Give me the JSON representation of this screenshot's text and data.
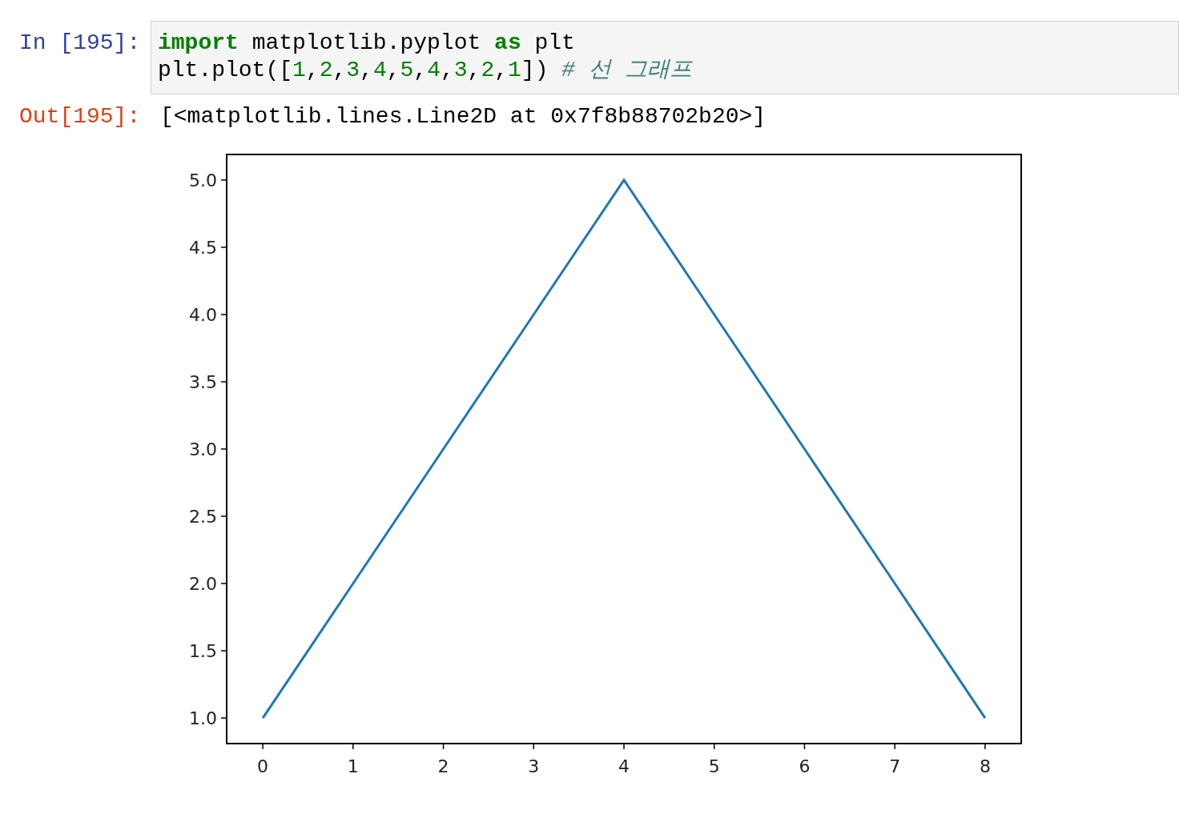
{
  "input_cell": {
    "prompt": "In [195]:",
    "code_lines": [
      [
        {
          "text": "import",
          "kind": "keyword"
        },
        {
          "text": " matplotlib.pyplot ",
          "kind": "plain"
        },
        {
          "text": "as",
          "kind": "keyword"
        },
        {
          "text": " plt",
          "kind": "plain"
        }
      ],
      [
        {
          "text": "plt.plot([",
          "kind": "plain"
        },
        {
          "text": "1",
          "kind": "number"
        },
        {
          "text": ",",
          "kind": "plain"
        },
        {
          "text": "2",
          "kind": "number"
        },
        {
          "text": ",",
          "kind": "plain"
        },
        {
          "text": "3",
          "kind": "number"
        },
        {
          "text": ",",
          "kind": "plain"
        },
        {
          "text": "4",
          "kind": "number"
        },
        {
          "text": ",",
          "kind": "plain"
        },
        {
          "text": "5",
          "kind": "number"
        },
        {
          "text": ",",
          "kind": "plain"
        },
        {
          "text": "4",
          "kind": "number"
        },
        {
          "text": ",",
          "kind": "plain"
        },
        {
          "text": "3",
          "kind": "number"
        },
        {
          "text": ",",
          "kind": "plain"
        },
        {
          "text": "2",
          "kind": "number"
        },
        {
          "text": ",",
          "kind": "plain"
        },
        {
          "text": "1",
          "kind": "number"
        },
        {
          "text": "]) ",
          "kind": "plain"
        },
        {
          "text": "# 선 그래프",
          "kind": "comment"
        }
      ]
    ]
  },
  "output_cell": {
    "prompt": "Out[195]:",
    "text": "[<matplotlib.lines.Line2D at 0x7f8b88702b20>]",
    "chart_data": {
      "type": "line",
      "x": [
        0,
        1,
        2,
        3,
        4,
        5,
        6,
        7,
        8
      ],
      "series": [
        {
          "color": "#1f77b4",
          "values": [
            1,
            2,
            3,
            4,
            5,
            4,
            3,
            2,
            1
          ]
        }
      ],
      "xlim": [
        -0.4,
        8.4
      ],
      "ylim": [
        0.81,
        5.19
      ],
      "xticks": [
        0,
        1,
        2,
        3,
        4,
        5,
        6,
        7,
        8
      ],
      "yticks": [
        {
          "value": 1,
          "label": "1.0"
        },
        {
          "value": 1.5,
          "label": "1.5"
        },
        {
          "value": 2,
          "label": "2.0"
        },
        {
          "value": 2.5,
          "label": "2.5"
        },
        {
          "value": 3,
          "label": "3.0"
        },
        {
          "value": 3.5,
          "label": "3.5"
        },
        {
          "value": 4,
          "label": "4.0"
        },
        {
          "value": 4.5,
          "label": "4.5"
        },
        {
          "value": 5,
          "label": "5.0"
        }
      ]
    }
  }
}
